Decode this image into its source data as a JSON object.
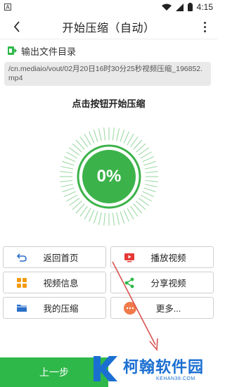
{
  "status_bar": {
    "time": "4:15",
    "left_badge": "A"
  },
  "header": {
    "title": "开始压缩（自动）"
  },
  "output": {
    "label": "输出文件目录",
    "path": "/cn.mediaio/vout/02月20日16时30分25秒视频压缩_196852.mp4"
  },
  "compress": {
    "hint": "点击按钮开始压缩",
    "percent": "0%"
  },
  "buttons": {
    "home": "返回首页",
    "play": "播放视频",
    "info": "视频信息",
    "share": "分享视频",
    "mine": "我的压缩",
    "more": "更多..."
  },
  "footer": {
    "prev": "上一步"
  },
  "watermark": {
    "name": "柯翰软件园",
    "url": "KEHAN38.COM"
  },
  "colors": {
    "accent": "#2fb84a",
    "gauge": "#3cb34a",
    "arrow": "#d9534f",
    "watermark": "#1a6fd1"
  }
}
